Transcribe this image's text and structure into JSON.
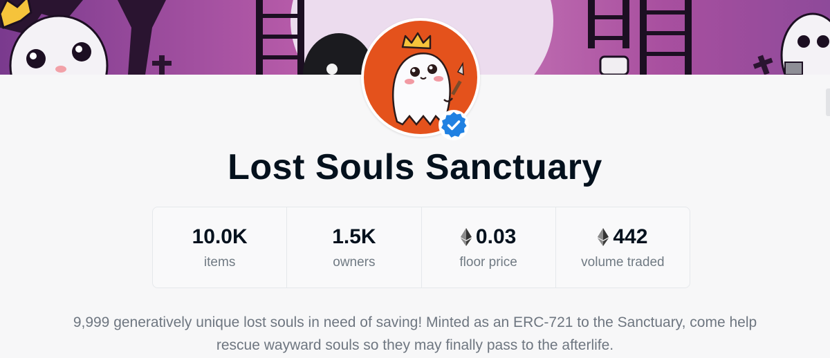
{
  "collection": {
    "name": "Lost Souls Sanctuary",
    "verified": true,
    "description": "9,999 generatively unique lost souls in need of saving! Minted as an ERC-721 to the Sanctuary, come help rescue wayward souls so they may finally pass to the afterlife."
  },
  "stats": [
    {
      "value": "10.0K",
      "label": "items",
      "currency_icon": "none"
    },
    {
      "value": "1.5K",
      "label": "owners",
      "currency_icon": "none"
    },
    {
      "value": "0.03",
      "label": "floor price",
      "currency_icon": "eth-icon"
    },
    {
      "value": "442",
      "label": "volume traded",
      "currency_icon": "eth-icon"
    }
  ],
  "colors": {
    "banner_purple": "#8a4a9e",
    "banner_pink": "#c478b6",
    "avatar_orange": "#e4521c",
    "verified_blue": "#2081e2",
    "title": "#04111d",
    "muted_text": "#707a83"
  }
}
